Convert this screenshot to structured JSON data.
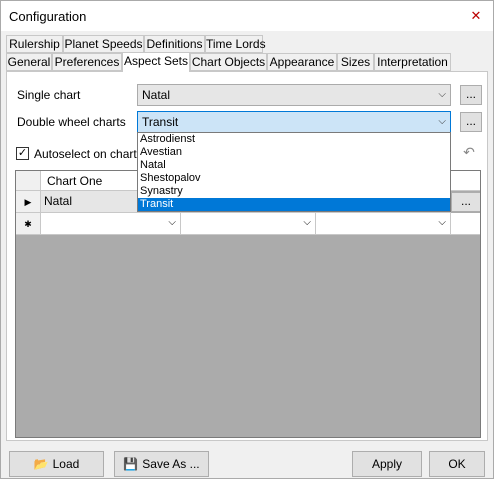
{
  "window": {
    "title": "Configuration",
    "close_glyph": "✕"
  },
  "tabs_back": [
    "Rulership",
    "Planet Speeds",
    "Definitions",
    "Time Lords"
  ],
  "tabs_front": [
    "General",
    "Preferences",
    "Aspect Sets",
    "Chart Objects",
    "Appearance",
    "Sizes",
    "Interpretation"
  ],
  "active_tab": "Aspect Sets",
  "single_chart": {
    "label": "Single chart",
    "value": "Natal"
  },
  "double_wheel": {
    "label": "Double wheel charts",
    "value": "Transit"
  },
  "ellipsis_label": "...",
  "autoselect": {
    "label": "Autoselect on chart ty",
    "checked": true
  },
  "dropdown_options": [
    "Astrodienst",
    "Avestian",
    "Natal",
    "Shestopalov",
    "Synastry",
    "Transit"
  ],
  "dropdown_selected": "Transit",
  "grid": {
    "columns": [
      "Chart One"
    ],
    "rows": [
      {
        "marker": "▶",
        "cells": [
          "Natal"
        ]
      },
      {
        "marker": "✱",
        "cells": [
          ""
        ]
      }
    ]
  },
  "buttons": {
    "load": "Load",
    "save_as": "Save As ...",
    "apply": "Apply",
    "ok": "OK"
  },
  "icons": {
    "close": "close-icon",
    "load": "folder-open-icon",
    "save": "floppy-disk-icon",
    "undo": "undo-icon",
    "dropdown": "chevron-down-icon"
  },
  "colors": {
    "selection": "#0078d7",
    "focus_fill": "#cce4f7",
    "grid_background": "#ababab"
  }
}
